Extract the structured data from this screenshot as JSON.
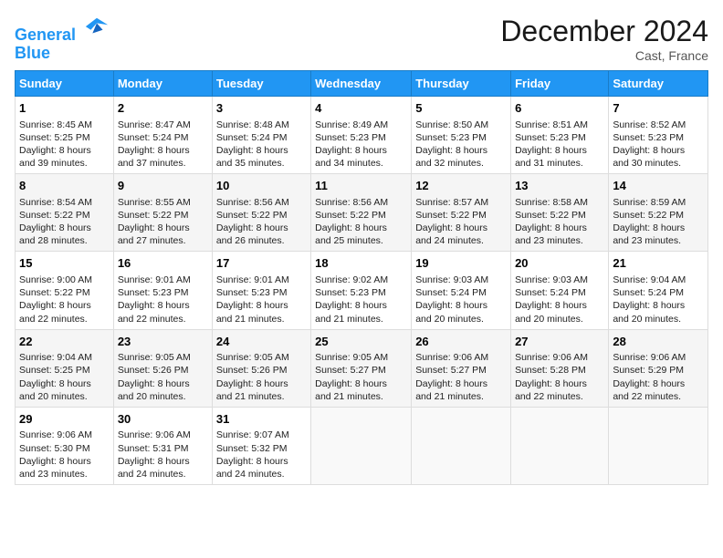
{
  "header": {
    "logo_line1": "General",
    "logo_line2": "Blue",
    "month": "December 2024",
    "location": "Cast, France"
  },
  "columns": [
    "Sunday",
    "Monday",
    "Tuesday",
    "Wednesday",
    "Thursday",
    "Friday",
    "Saturday"
  ],
  "weeks": [
    [
      {
        "day": "1",
        "info": "Sunrise: 8:45 AM\nSunset: 5:25 PM\nDaylight: 8 hours\nand 39 minutes."
      },
      {
        "day": "2",
        "info": "Sunrise: 8:47 AM\nSunset: 5:24 PM\nDaylight: 8 hours\nand 37 minutes."
      },
      {
        "day": "3",
        "info": "Sunrise: 8:48 AM\nSunset: 5:24 PM\nDaylight: 8 hours\nand 35 minutes."
      },
      {
        "day": "4",
        "info": "Sunrise: 8:49 AM\nSunset: 5:23 PM\nDaylight: 8 hours\nand 34 minutes."
      },
      {
        "day": "5",
        "info": "Sunrise: 8:50 AM\nSunset: 5:23 PM\nDaylight: 8 hours\nand 32 minutes."
      },
      {
        "day": "6",
        "info": "Sunrise: 8:51 AM\nSunset: 5:23 PM\nDaylight: 8 hours\nand 31 minutes."
      },
      {
        "day": "7",
        "info": "Sunrise: 8:52 AM\nSunset: 5:23 PM\nDaylight: 8 hours\nand 30 minutes."
      }
    ],
    [
      {
        "day": "8",
        "info": "Sunrise: 8:54 AM\nSunset: 5:22 PM\nDaylight: 8 hours\nand 28 minutes."
      },
      {
        "day": "9",
        "info": "Sunrise: 8:55 AM\nSunset: 5:22 PM\nDaylight: 8 hours\nand 27 minutes."
      },
      {
        "day": "10",
        "info": "Sunrise: 8:56 AM\nSunset: 5:22 PM\nDaylight: 8 hours\nand 26 minutes."
      },
      {
        "day": "11",
        "info": "Sunrise: 8:56 AM\nSunset: 5:22 PM\nDaylight: 8 hours\nand 25 minutes."
      },
      {
        "day": "12",
        "info": "Sunrise: 8:57 AM\nSunset: 5:22 PM\nDaylight: 8 hours\nand 24 minutes."
      },
      {
        "day": "13",
        "info": "Sunrise: 8:58 AM\nSunset: 5:22 PM\nDaylight: 8 hours\nand 23 minutes."
      },
      {
        "day": "14",
        "info": "Sunrise: 8:59 AM\nSunset: 5:22 PM\nDaylight: 8 hours\nand 23 minutes."
      }
    ],
    [
      {
        "day": "15",
        "info": "Sunrise: 9:00 AM\nSunset: 5:22 PM\nDaylight: 8 hours\nand 22 minutes."
      },
      {
        "day": "16",
        "info": "Sunrise: 9:01 AM\nSunset: 5:23 PM\nDaylight: 8 hours\nand 22 minutes."
      },
      {
        "day": "17",
        "info": "Sunrise: 9:01 AM\nSunset: 5:23 PM\nDaylight: 8 hours\nand 21 minutes."
      },
      {
        "day": "18",
        "info": "Sunrise: 9:02 AM\nSunset: 5:23 PM\nDaylight: 8 hours\nand 21 minutes."
      },
      {
        "day": "19",
        "info": "Sunrise: 9:03 AM\nSunset: 5:24 PM\nDaylight: 8 hours\nand 20 minutes."
      },
      {
        "day": "20",
        "info": "Sunrise: 9:03 AM\nSunset: 5:24 PM\nDaylight: 8 hours\nand 20 minutes."
      },
      {
        "day": "21",
        "info": "Sunrise: 9:04 AM\nSunset: 5:24 PM\nDaylight: 8 hours\nand 20 minutes."
      }
    ],
    [
      {
        "day": "22",
        "info": "Sunrise: 9:04 AM\nSunset: 5:25 PM\nDaylight: 8 hours\nand 20 minutes."
      },
      {
        "day": "23",
        "info": "Sunrise: 9:05 AM\nSunset: 5:26 PM\nDaylight: 8 hours\nand 20 minutes."
      },
      {
        "day": "24",
        "info": "Sunrise: 9:05 AM\nSunset: 5:26 PM\nDaylight: 8 hours\nand 21 minutes."
      },
      {
        "day": "25",
        "info": "Sunrise: 9:05 AM\nSunset: 5:27 PM\nDaylight: 8 hours\nand 21 minutes."
      },
      {
        "day": "26",
        "info": "Sunrise: 9:06 AM\nSunset: 5:27 PM\nDaylight: 8 hours\nand 21 minutes."
      },
      {
        "day": "27",
        "info": "Sunrise: 9:06 AM\nSunset: 5:28 PM\nDaylight: 8 hours\nand 22 minutes."
      },
      {
        "day": "28",
        "info": "Sunrise: 9:06 AM\nSunset: 5:29 PM\nDaylight: 8 hours\nand 22 minutes."
      }
    ],
    [
      {
        "day": "29",
        "info": "Sunrise: 9:06 AM\nSunset: 5:30 PM\nDaylight: 8 hours\nand 23 minutes."
      },
      {
        "day": "30",
        "info": "Sunrise: 9:06 AM\nSunset: 5:31 PM\nDaylight: 8 hours\nand 24 minutes."
      },
      {
        "day": "31",
        "info": "Sunrise: 9:07 AM\nSunset: 5:32 PM\nDaylight: 8 hours\nand 24 minutes."
      },
      null,
      null,
      null,
      null
    ]
  ]
}
